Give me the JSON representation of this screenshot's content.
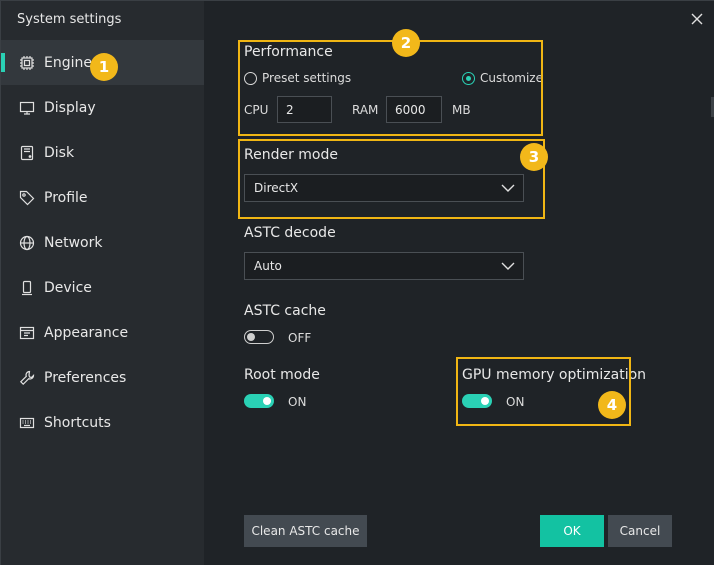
{
  "window": {
    "title": "System settings"
  },
  "sidebar": {
    "items": [
      {
        "label": "Engine",
        "icon": "cpu-icon",
        "active": true
      },
      {
        "label": "Display",
        "icon": "monitor-icon"
      },
      {
        "label": "Disk",
        "icon": "disk-icon"
      },
      {
        "label": "Profile",
        "icon": "tag-icon"
      },
      {
        "label": "Network",
        "icon": "globe-icon"
      },
      {
        "label": "Device",
        "icon": "phone-icon"
      },
      {
        "label": "Appearance",
        "icon": "appearance-icon"
      },
      {
        "label": "Preferences",
        "icon": "wrench-icon"
      },
      {
        "label": "Shortcuts",
        "icon": "keyboard-icon"
      }
    ]
  },
  "performance": {
    "title": "Performance",
    "preset_label": "Preset settings",
    "customize_label": "Customize",
    "selected": "Customize",
    "cpu_label": "CPU",
    "cpu_value": "2",
    "ram_label": "RAM",
    "ram_value": "6000",
    "ram_unit": "MB"
  },
  "render_mode": {
    "title": "Render mode",
    "value": "DirectX"
  },
  "astc_decode": {
    "title": "ASTC decode",
    "value": "Auto"
  },
  "astc_cache": {
    "title": "ASTC cache",
    "state": "OFF"
  },
  "root_mode": {
    "title": "Root mode",
    "state": "ON"
  },
  "gpu_memory": {
    "title": "GPU memory optimization",
    "state": "ON"
  },
  "buttons": {
    "clean": "Clean ASTC cache",
    "ok": "OK",
    "cancel": "Cancel"
  },
  "badges": [
    "1",
    "2",
    "3",
    "4"
  ],
  "colors": {
    "accent": "#2ad1b5",
    "ok_button": "#13c2a2",
    "highlight": "#f0b614",
    "badge": "#f2b81a"
  }
}
